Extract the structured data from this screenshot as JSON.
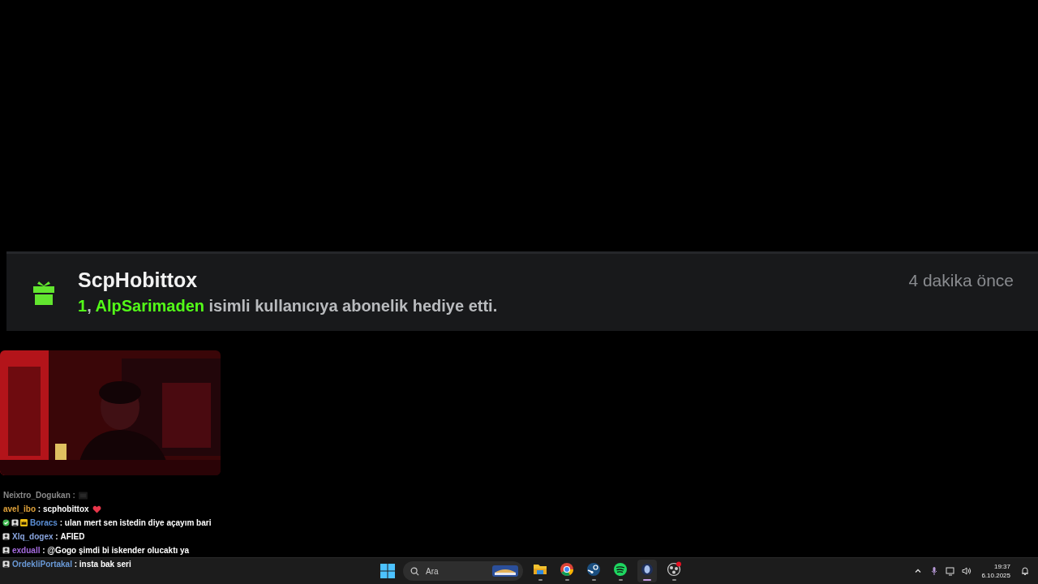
{
  "gift_alert": {
    "user": "ScpHobittox",
    "time": "4 dakika önce",
    "count": "1",
    "separator": ",",
    "recipient": "AlpSarimaden",
    "text": "isimli kullanıcıya abonelik hediye etti."
  },
  "chat": [
    {
      "user": "Neixtro_Dogukan",
      "color": "#8a8a8a",
      "faded": true,
      "separator": ":"
    },
    {
      "user": "avel_ibo",
      "color": "#e0a23a",
      "faded": false,
      "separator": ":",
      "text": "scphobittox",
      "emote": {
        "kind": "heart"
      }
    },
    {
      "user": "Boracs",
      "color": "#5b8fd6",
      "faded": false,
      "badges": [
        {
          "kind": "verified"
        },
        {
          "kind": "avatar"
        },
        {
          "kind": "crown"
        }
      ],
      "separator": ":",
      "text": "ulan mert sen istedin diye açayım bari"
    },
    {
      "user": "Xlq_dogex",
      "color": "#8aa6e0",
      "faded": false,
      "badges": [
        {
          "kind": "avatar"
        }
      ],
      "separator": ":",
      "text": "AFIED"
    },
    {
      "user": "exduall",
      "color": "#a66ce0",
      "faded": false,
      "badges": [
        {
          "kind": "avatar"
        }
      ],
      "separator": ":",
      "text": "@Gogo şimdi bi iskender olucaktı ya"
    },
    {
      "user": "OrdekliPortakal",
      "color": "#6a9ad8",
      "faded": false,
      "badges": [
        {
          "kind": "avatar"
        }
      ],
      "separator": ":",
      "text": "insta bak seri"
    }
  ],
  "taskbar": {
    "search": {
      "placeholder": "Ara"
    },
    "apps": [
      {
        "kind": "folder",
        "active": false
      },
      {
        "kind": "chrome",
        "active": false
      },
      {
        "kind": "steam",
        "active": false
      },
      {
        "kind": "spotify",
        "active": false
      },
      {
        "kind": "orb",
        "active": true
      },
      {
        "kind": "obs",
        "active": false
      }
    ],
    "time": "19:37",
    "date": "6.10.2025"
  }
}
